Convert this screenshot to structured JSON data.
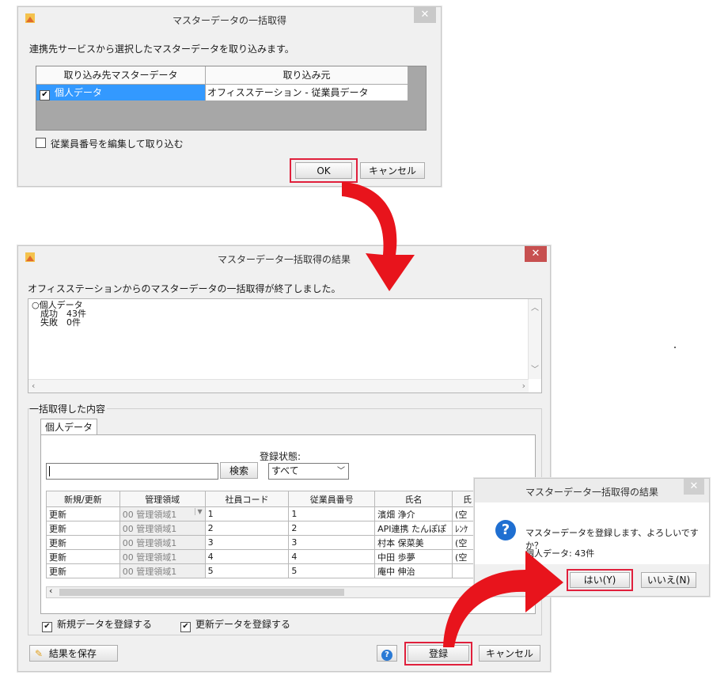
{
  "dialog1": {
    "title": "マスターデータの一括取得",
    "description": "連携先サービスから選択したマスターデータを取り込みます。",
    "col_target": "取り込み先マスターデータ",
    "col_source": "取り込み元",
    "row_target": "個人データ",
    "row_source": "オフィスステーション - 従業員データ",
    "edit_checkbox": "従業員番号を編集して取り込む",
    "ok": "OK",
    "cancel": "キャンセル"
  },
  "dialog2": {
    "title": "マスターデータ一括取得の結果",
    "message": "オフィスステーションからのマスターデータの一括取得が終了しました。",
    "log": [
      "○個人データ",
      "　成功　43件",
      "　失敗　0件"
    ],
    "group_label": "一括取得した内容",
    "tab": "個人データ",
    "status_label": "登録状態:",
    "search_value": "",
    "search_button": "検索",
    "status_value": "すべて",
    "table": {
      "headers": [
        "新規/更新",
        "管理領域",
        "社員コード",
        "従業員番号",
        "氏名",
        "氏"
      ],
      "rows": [
        [
          "更新",
          "00 管理領域1",
          "1",
          "1",
          "濱畑 浄介",
          "(空"
        ],
        [
          "更新",
          "00 管理領域1",
          "2",
          "2",
          "API連携 たんぽぽ",
          "ﾚﾝｹ"
        ],
        [
          "更新",
          "00 管理領域1",
          "3",
          "3",
          "村本 保菜美",
          "(空"
        ],
        [
          "更新",
          "00 管理領域1",
          "4",
          "4",
          "中田 歩夢",
          "(空"
        ],
        [
          "更新",
          "00 管理領域1",
          "5",
          "5",
          "庵中 伸治",
          ""
        ]
      ]
    },
    "chk_new": "新規データを登録する",
    "chk_update": "更新データを登録する",
    "save_result": "結果を保存",
    "register": "登録",
    "cancel": "キャンセル"
  },
  "dialog3": {
    "title": "マスターデータ一括取得の結果",
    "question": "マスターデータを登録します、よろしいですか？",
    "count": "個人データ: 43件",
    "yes": "はい(Y)",
    "no": "いいえ(N)"
  },
  "colors": {
    "accent_red": "#e0203c",
    "selection_blue": "#3399ff",
    "close_red": "#c75050"
  }
}
